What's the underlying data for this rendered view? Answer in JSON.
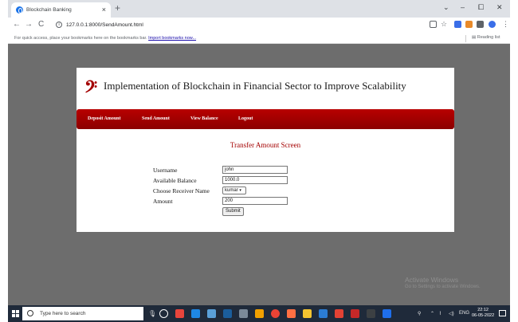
{
  "browser": {
    "tab_title": "Blockchain Banking",
    "tab_close": "×",
    "new_tab": "+",
    "url": "127.0.0.1:8000/SendAmount.html",
    "window_controls": [
      "⌄",
      "–",
      "⧠",
      "✕"
    ],
    "nav": {
      "back": "←",
      "forward": "→",
      "reload": "C"
    },
    "bookmarks_message": "For quick access, place your bookmarks here on the bookmarks bar.",
    "bookmarks_link": "Import bookmarks now...",
    "reading_list": "Reading list"
  },
  "page": {
    "logo": "𝄢",
    "site_title": "Implementation of Blockchain in Financial Sector to Improve Scalability",
    "menu": [
      "Deposit Amount",
      "Send Amount",
      "View Balance",
      "Logout"
    ],
    "screen_title": "Transfer Amount Screen",
    "form": {
      "username_label": "Username",
      "username_value": "john",
      "balance_label": "Available Balance",
      "balance_value": "1000.0",
      "receiver_label": "Choose Receiver Name",
      "receiver_value": "kumar",
      "amount_label": "Amount",
      "amount_value": "200",
      "submit_label": "Submit"
    }
  },
  "watermark": {
    "line1": "Activate Windows",
    "line2": "Go to Settings to activate Windows."
  },
  "taskbar": {
    "search_placeholder": "Type here to search",
    "time": "22:12",
    "date": "06-05-2022"
  },
  "colors": {
    "accent": "#a40000",
    "menubar": "#b80000",
    "background": "#6d6d6d",
    "taskbar": "#1f2a3a"
  }
}
